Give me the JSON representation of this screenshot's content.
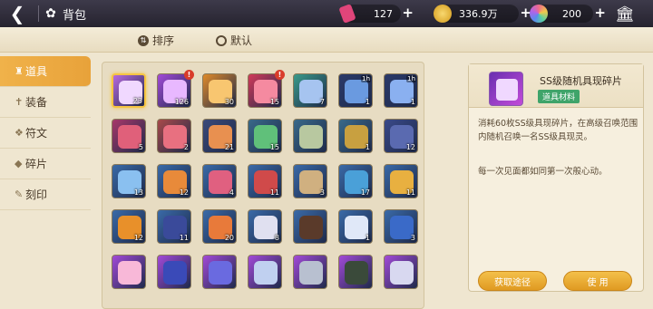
{
  "header": {
    "title": "背包",
    "resources": [
      {
        "name": "crystal",
        "value": "127",
        "color": "#e0457a"
      },
      {
        "name": "gold",
        "value": "336.9万",
        "color": "#e8b232"
      },
      {
        "name": "gem",
        "value": "200",
        "color": "#b064e8"
      }
    ]
  },
  "sort": {
    "order_label": "排序",
    "default_label": "默认"
  },
  "sidebar": {
    "items": [
      {
        "label": "道具",
        "icon": "potion-icon",
        "active": true
      },
      {
        "label": "装备",
        "icon": "sword-icon",
        "active": false
      },
      {
        "label": "符文",
        "icon": "rune-icon",
        "active": false
      },
      {
        "label": "碎片",
        "icon": "shard-icon",
        "active": false
      },
      {
        "label": "刻印",
        "icon": "seal-icon",
        "active": false
      }
    ]
  },
  "grid": {
    "rows": [
      [
        {
          "count": "23",
          "bg": "#b86adf",
          "art": "#f0d8ff",
          "selected": true
        },
        {
          "count": "126",
          "bg": "#a24ad8",
          "art": "#e8b8ff",
          "badge": "!"
        },
        {
          "count": "30",
          "bg": "#e08a2a",
          "art": "#f8c670"
        },
        {
          "count": "15",
          "bg": "#d23a5a",
          "art": "#f58aa0",
          "badge": "!"
        },
        {
          "count": "7",
          "bg": "#3a9a8a",
          "art": "#a6c4f0"
        },
        {
          "count": "1",
          "bg": "#2b3a6a",
          "art": "#6a9ae0",
          "timer": "1h"
        },
        {
          "count": "1",
          "bg": "#2b3a6a",
          "art": "#8ab0f0",
          "timer": "1h"
        }
      ],
      [
        {
          "count": "5",
          "bg": "#a8386a",
          "art": "#e0607a"
        },
        {
          "count": "2",
          "bg": "#a84a4a",
          "art": "#e87080"
        },
        {
          "count": "21",
          "bg": "#3b4a7a",
          "art": "#e89050"
        },
        {
          "count": "15",
          "bg": "#3a6a8a",
          "art": "#60c07a"
        },
        {
          "count": "",
          "bg": "#3a6a8a",
          "art": "#b8c8a0"
        },
        {
          "count": "1",
          "bg": "#3a6a8a",
          "art": "#c8a040"
        },
        {
          "count": "12",
          "bg": "#3a4a8a",
          "art": "#5a6ab0"
        }
      ],
      [
        {
          "count": "13",
          "bg": "#3a6aa8",
          "art": "#8ac0f0"
        },
        {
          "count": "12",
          "bg": "#3a6aa8",
          "art": "#e88a3a"
        },
        {
          "count": "4",
          "bg": "#3a6aa8",
          "art": "#e06080"
        },
        {
          "count": "11",
          "bg": "#3a6aa8",
          "art": "#d04a4a"
        },
        {
          "count": "3",
          "bg": "#3a6aa8",
          "art": "#d0b080"
        },
        {
          "count": "17",
          "bg": "#3a6aa8",
          "art": "#4aa0d8"
        },
        {
          "count": "11",
          "bg": "#3a6aa8",
          "art": "#e8b040"
        }
      ],
      [
        {
          "count": "12",
          "bg": "#3a6aa8",
          "art": "#e8902a"
        },
        {
          "count": "11",
          "bg": "#3a6aa8",
          "art": "#3a4a9a"
        },
        {
          "count": "20",
          "bg": "#3a6aa8",
          "art": "#e87a3a"
        },
        {
          "count": "8",
          "bg": "#3a6aa8",
          "art": "#e0e0f0"
        },
        {
          "count": "",
          "bg": "#3a6aa8",
          "art": "#5a3a2a"
        },
        {
          "count": "1",
          "bg": "#3a6aa8",
          "art": "#e0e8f8"
        },
        {
          "count": "3",
          "bg": "#3a6aa8",
          "art": "#3a6ac8"
        }
      ],
      [
        {
          "count": "",
          "bg": "#a24ad8",
          "art": "#f8b8d8"
        },
        {
          "count": "",
          "bg": "#a24ad8",
          "art": "#3a4ab8"
        },
        {
          "count": "",
          "bg": "#a24ad8",
          "art": "#6a6ae0"
        },
        {
          "count": "",
          "bg": "#a24ad8",
          "art": "#c0d0f0"
        },
        {
          "count": "",
          "bg": "#a24ad8",
          "art": "#b8c0d0"
        },
        {
          "count": "",
          "bg": "#a24ad8",
          "art": "#3a4a3a"
        },
        {
          "count": "",
          "bg": "#a24ad8",
          "art": "#d8d8f0"
        }
      ]
    ]
  },
  "detail": {
    "name": "SS级随机具现碎片",
    "tag": "道具材料",
    "description": "消耗60枚SS级具现碎片，在高级召唤范围内随机召唤一名SS级具现灵。",
    "flavor": "每一次见面都如同第一次般心动。",
    "source_button": "获取途径",
    "use_button": "使 用"
  }
}
